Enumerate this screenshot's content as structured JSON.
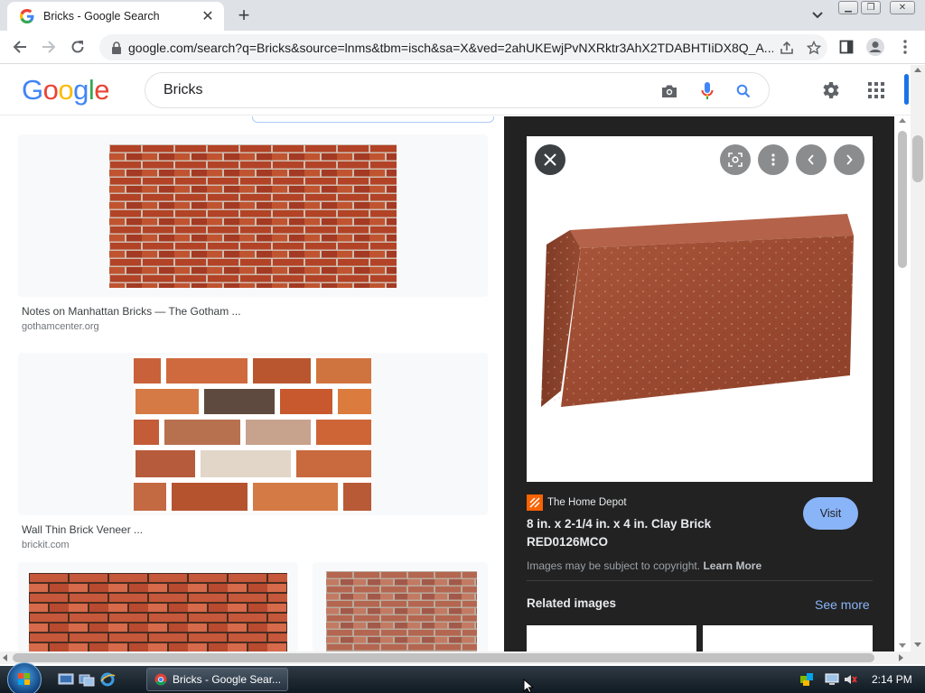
{
  "browser": {
    "tab_title": "Bricks - Google Search",
    "url": "google.com/search?q=Bricks&source=lnms&tbm=isch&sa=X&ved=2ahUKEwjPvNXRktr3AhX2TDABHTIiDX8Q_A..."
  },
  "google": {
    "logo": "Google",
    "query": "Bricks",
    "colors": {
      "blue": "#4285F4",
      "red": "#EA4335",
      "yellow": "#FBBC05",
      "green": "#34A853"
    }
  },
  "results": [
    {
      "title": "Notes on Manhattan Bricks — The Gotham ...",
      "site": "gothamcenter.org"
    },
    {
      "title": "Wall Thin Brick Veneer ...",
      "site": "brickit.com"
    }
  ],
  "preview": {
    "source": "The Home Depot",
    "title_line1": "8 in. x 2-1/4 in. x 4 in. Clay Brick",
    "title_line2": "RED0126MCO",
    "visit_label": "Visit",
    "copyright": "Images may be subject to copyright.",
    "learn_more": "Learn More",
    "related_heading": "Related images",
    "see_more": "See more"
  },
  "taskbar": {
    "chrome_label": "Bricks - Google Sear...",
    "clock": "2:14 PM"
  }
}
